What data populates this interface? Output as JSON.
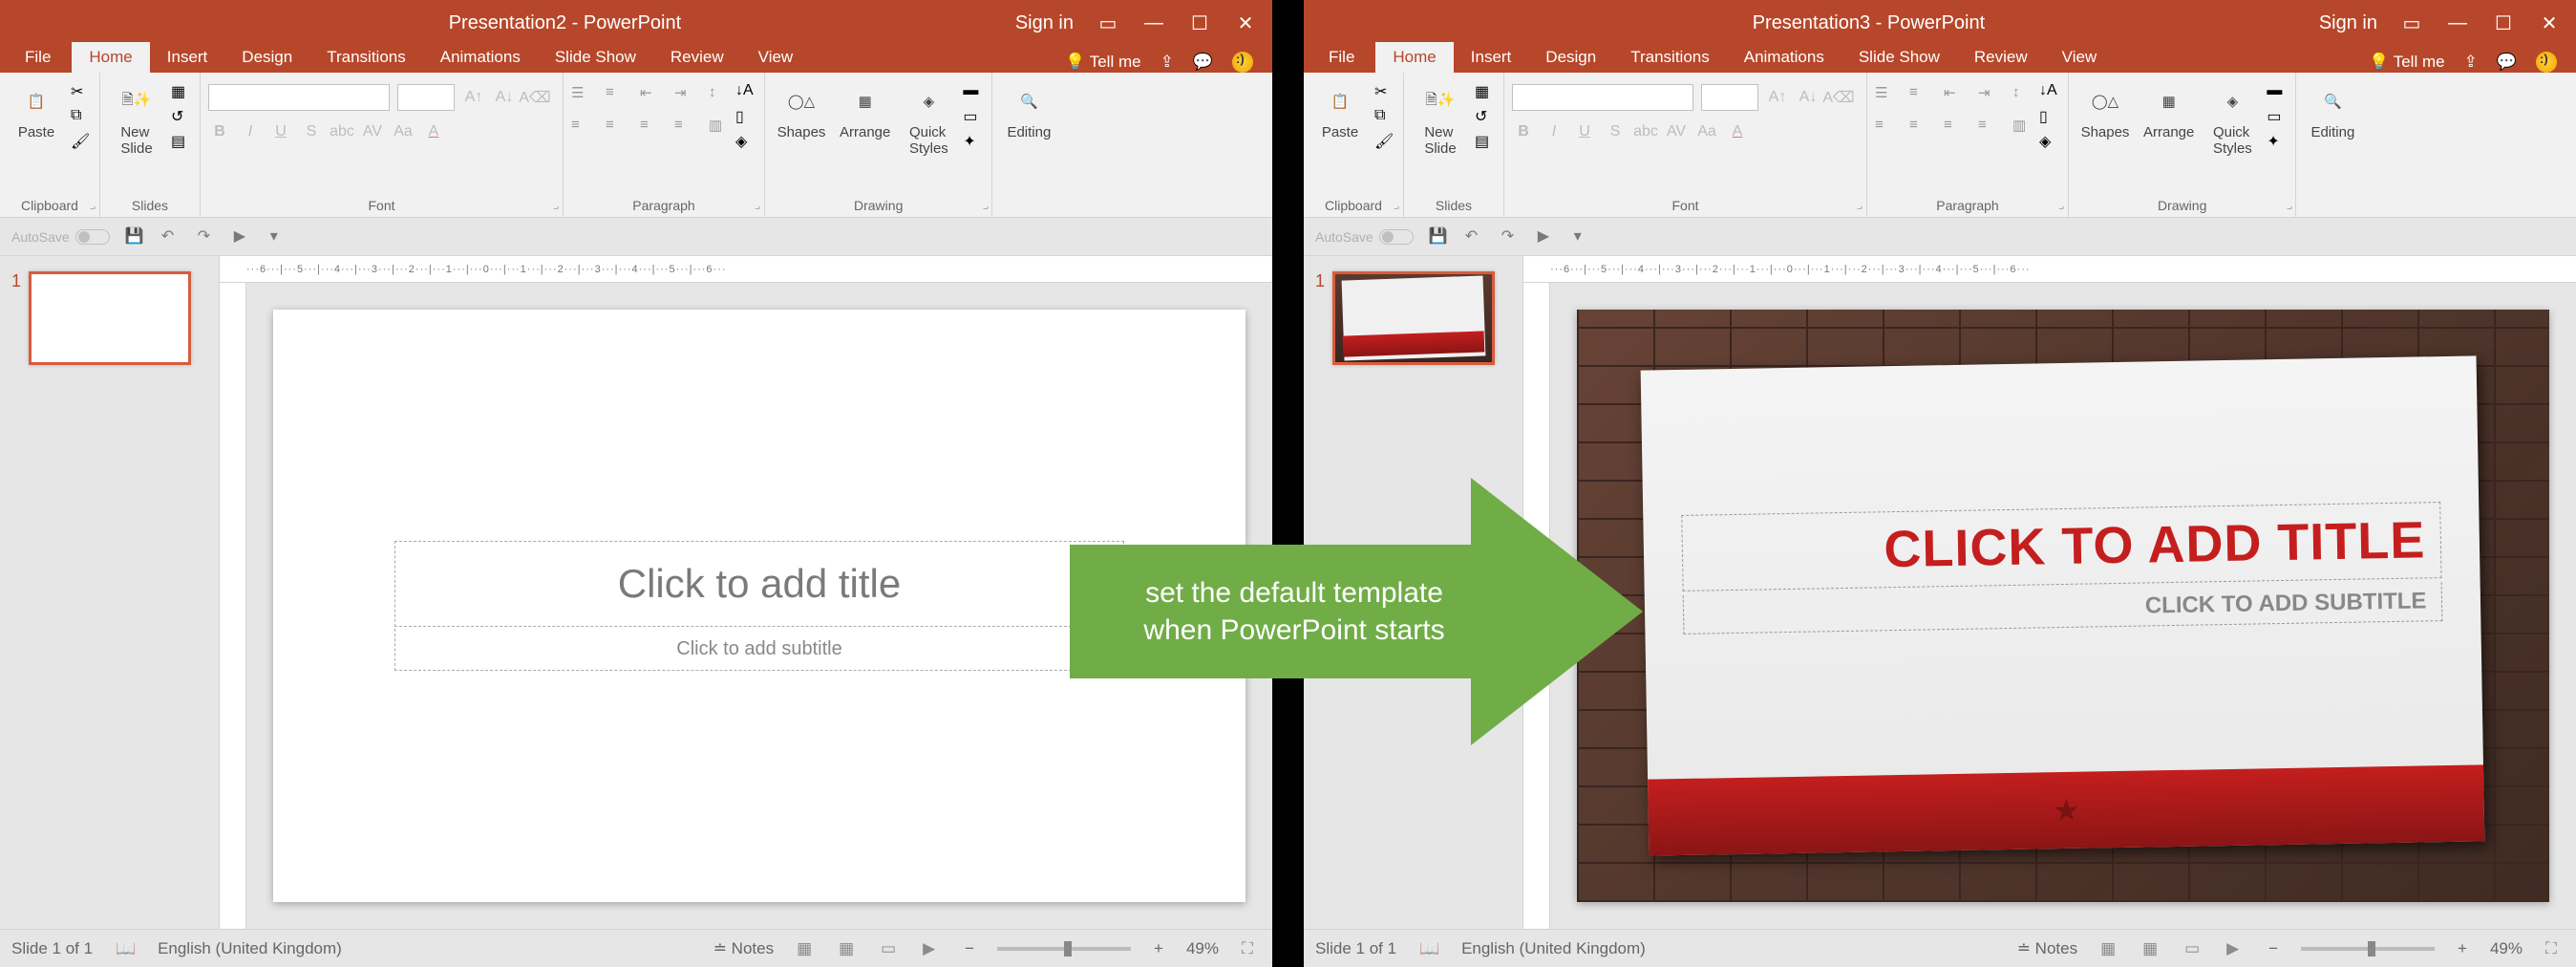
{
  "left": {
    "title": "Presentation2 - PowerPoint",
    "signin": "Sign in",
    "tabs": {
      "file": "File",
      "home": "Home",
      "insert": "Insert",
      "design": "Design",
      "transitions": "Transitions",
      "animations": "Animations",
      "slideshow": "Slide Show",
      "review": "Review",
      "view": "View",
      "tellme": "Tell me"
    },
    "ribbon": {
      "clipboard": {
        "label": "Clipboard",
        "paste": "Paste"
      },
      "slides": {
        "label": "Slides",
        "newslide": "New\nSlide"
      },
      "font": {
        "label": "Font"
      },
      "paragraph": {
        "label": "Paragraph"
      },
      "drawing": {
        "label": "Drawing",
        "shapes": "Shapes",
        "arrange": "Arrange",
        "quick": "Quick\nStyles"
      },
      "editing": {
        "label": "Editing"
      }
    },
    "qat": {
      "autosave": "AutoSave",
      "off": "Off"
    },
    "thumb_num": "1",
    "slide": {
      "title": "Click to add title",
      "subtitle": "Click to add subtitle"
    },
    "status": {
      "slide": "Slide 1 of 1",
      "lang": "English (United Kingdom)",
      "notes": "Notes",
      "zoom": "49%"
    }
  },
  "right": {
    "title": "Presentation3 - PowerPoint",
    "signin": "Sign in",
    "tabs": {
      "file": "File",
      "home": "Home",
      "insert": "Insert",
      "design": "Design",
      "transitions": "Transitions",
      "animations": "Animations",
      "slideshow": "Slide Show",
      "review": "Review",
      "view": "View",
      "tellme": "Tell me"
    },
    "ribbon": {
      "clipboard": {
        "label": "Clipboard",
        "paste": "Paste"
      },
      "slides": {
        "label": "Slides",
        "newslide": "New\nSlide"
      },
      "font": {
        "label": "Font"
      },
      "paragraph": {
        "label": "Paragraph"
      },
      "drawing": {
        "label": "Drawing",
        "shapes": "Shapes",
        "arrange": "Arrange",
        "quick": "Quick\nStyles"
      },
      "editing": {
        "label": "Editing"
      }
    },
    "qat": {
      "autosave": "AutoSave",
      "off": "Off"
    },
    "thumb_num": "1",
    "slide": {
      "title": "CLICK TO ADD TITLE",
      "subtitle": "CLICK TO ADD SUBTITLE"
    },
    "status": {
      "slide": "Slide 1 of 1",
      "lang": "English (United Kingdom)",
      "notes": "Notes",
      "zoom": "49%"
    }
  },
  "arrow_text": "set the default template\nwhen PowerPoint starts"
}
